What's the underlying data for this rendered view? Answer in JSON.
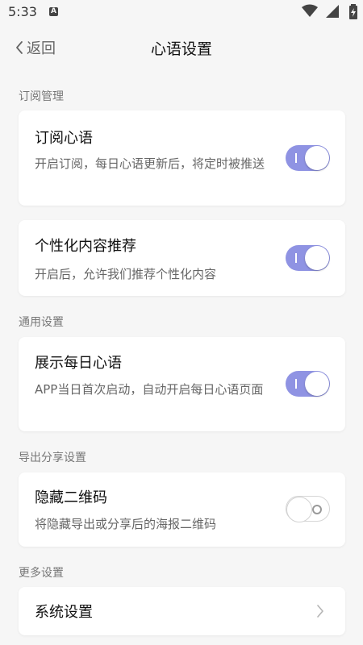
{
  "status": {
    "time": "5:33",
    "notif_icon": "A"
  },
  "header": {
    "back_label": "返回",
    "title": "心语设置"
  },
  "sections": [
    {
      "title": "订阅管理"
    },
    {
      "title": "通用设置"
    },
    {
      "title": "导出分享设置"
    },
    {
      "title": "更多设置"
    }
  ],
  "settings": {
    "subscribe": {
      "title": "订阅心语",
      "desc": "开启订阅，每日心语更新后，将定时被推送",
      "enabled": true
    },
    "personalized": {
      "title": "个性化内容推荐",
      "desc": "开启后，允许我们推荐个性化内容",
      "enabled": true
    },
    "daily_display": {
      "title": "展示每日心语",
      "desc": "APP当日首次启动，自动开启每日心语页面",
      "enabled": true
    },
    "hide_qr": {
      "title": "隐藏二维码",
      "desc": "将隐藏导出或分享后的海报二维码",
      "enabled": false
    },
    "system": {
      "title": "系统设置"
    }
  },
  "colors": {
    "toggle_on": "#8f93e3",
    "background": "#f6f6f6"
  }
}
